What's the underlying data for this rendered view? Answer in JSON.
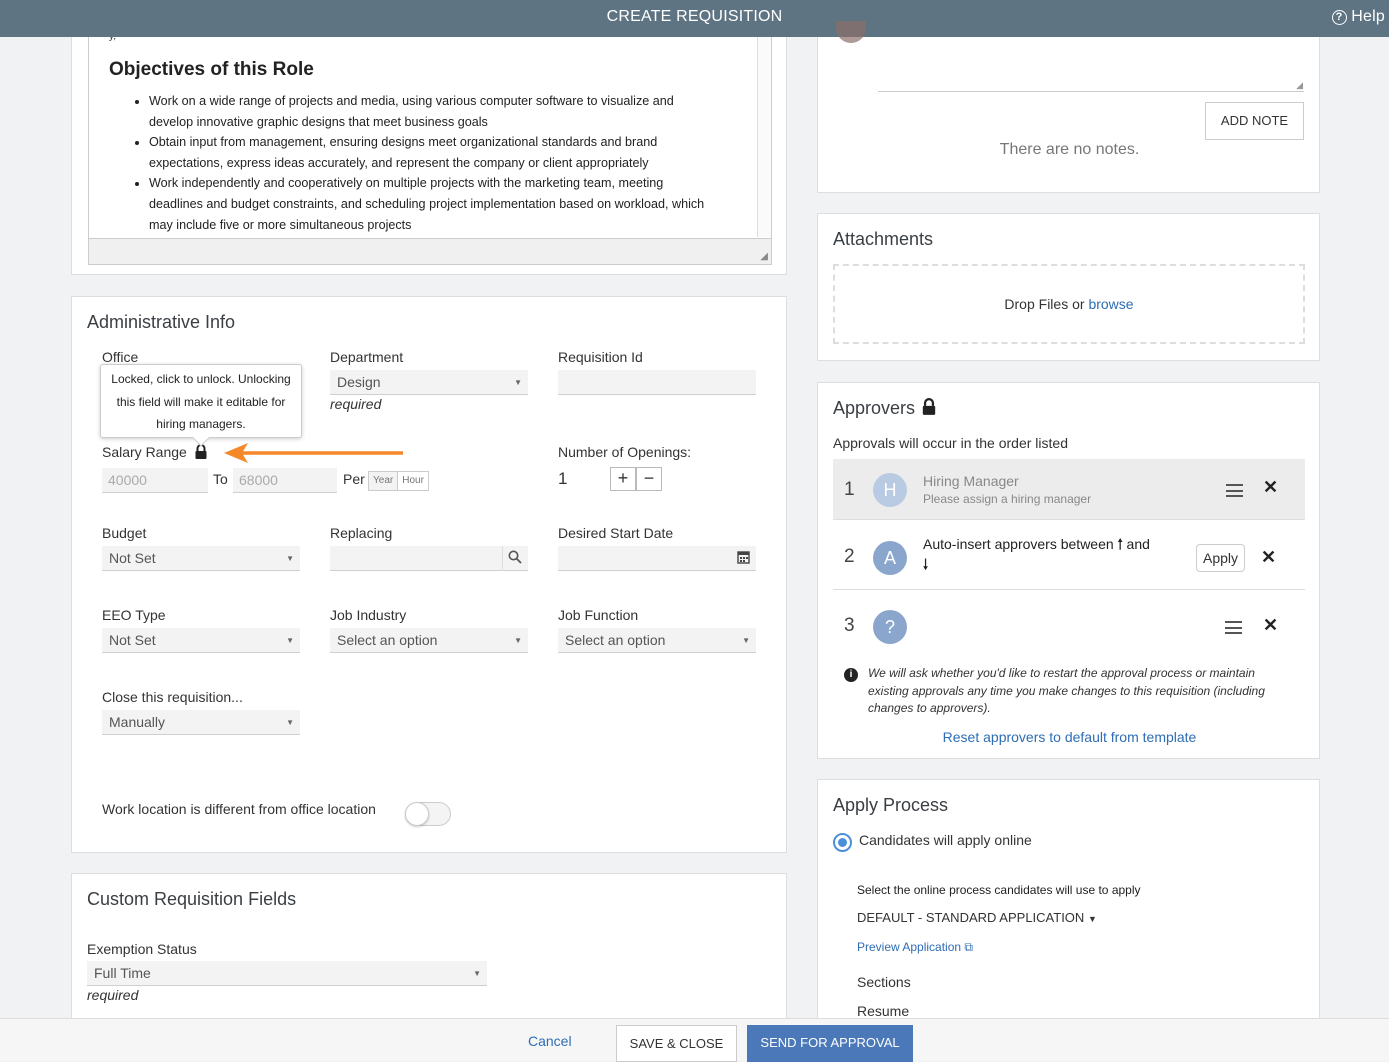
{
  "header": {
    "title": "CREATE REQUISITION",
    "help_label": "Help"
  },
  "description": {
    "heading": "Objectives of this Role",
    "bullets": [
      "Work on a wide range of projects and media, using various computer software to visualize and develop innovative graphic designs that meet business goals",
      "Obtain input from management, ensuring designs meet organizational standards and brand expectations, express ideas accurately, and represent the company or client appropriately",
      "Work independently and cooperatively on multiple projects with the marketing team, meeting deadlines and budget constraints, and scheduling project implementation based on workload, which may include five or more simultaneous projects"
    ]
  },
  "admin": {
    "title": "Administrative Info",
    "office_label": "Office",
    "tooltip": "Locked, click to unlock. Unlocking this field will make it editable for hiring managers.",
    "department_label": "Department",
    "department_value": "Design",
    "required": "required",
    "requisition_id_label": "Requisition Id",
    "salary_label": "Salary Range",
    "salary_min": "40000",
    "salary_to": "To",
    "salary_max": "68000",
    "per_label": "Per",
    "per_year": "Year",
    "per_hour": "Hour",
    "openings_label": "Number of Openings:",
    "openings_value": "1",
    "budget_label": "Budget",
    "budget_value": "Not Set",
    "replacing_label": "Replacing",
    "start_date_label": "Desired Start Date",
    "eeo_label": "EEO Type",
    "eeo_value": "Not Set",
    "industry_label": "Job Industry",
    "industry_value": "Select an option",
    "function_label": "Job Function",
    "function_value": "Select an option",
    "close_label": "Close this requisition...",
    "close_value": "Manually",
    "work_location_label": "Work location is different from office location"
  },
  "custom": {
    "title": "Custom Requisition Fields",
    "exemption_label": "Exemption Status",
    "exemption_value": "Full Time",
    "required": "required"
  },
  "notes": {
    "add_note": "ADD NOTE",
    "empty": "There are no notes."
  },
  "attachments": {
    "title": "Attachments",
    "drop_text": "Drop Files or ",
    "browse": "browse"
  },
  "approvers": {
    "title": "Approvers",
    "order_text": "Approvals will occur in the order listed",
    "items": [
      {
        "num": "1",
        "initial": "H",
        "name": "Hiring Manager",
        "sub": "Please assign a hiring manager"
      },
      {
        "num": "2",
        "initial": "A",
        "name_pre": "Auto-insert approvers between",
        "name_mid": "and",
        "apply": "Apply"
      },
      {
        "num": "3",
        "initial": "?"
      }
    ],
    "info": "We will ask whether you'd like to restart the approval process or maintain existing approvals any time you make changes to this requisition (including changes to approvers).",
    "reset_link": "Reset approvers to default from template"
  },
  "apply_process": {
    "title": "Apply Process",
    "option": "Candidates will apply online",
    "select_text": "Select the online process candidates will use to apply",
    "process_value": "DEFAULT - STANDARD APPLICATION",
    "preview": "Preview Application",
    "sections": "Sections",
    "resume": "Resume"
  },
  "footer": {
    "cancel": "Cancel",
    "save_close": "SAVE & CLOSE",
    "send": "SEND FOR APPROVAL"
  },
  "colors": {
    "header_bg": "#5f7483",
    "primary": "#4a78b8",
    "link": "#2e6db4",
    "arrow": "#f5892a",
    "avatar": "#8aa6cc"
  }
}
